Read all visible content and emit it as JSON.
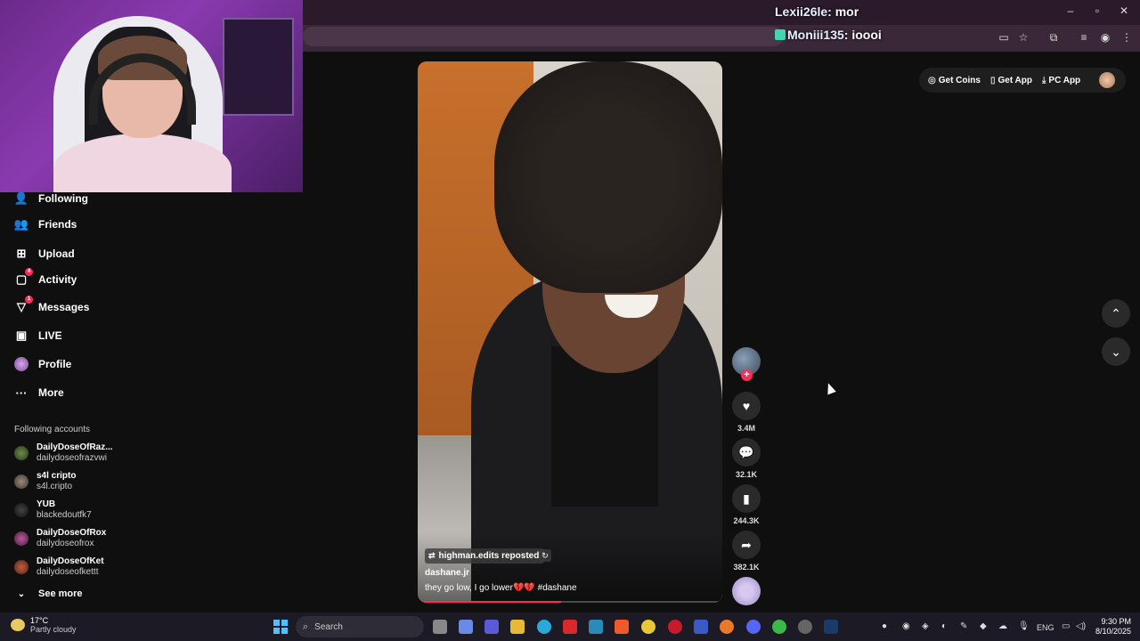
{
  "chat": [
    {
      "user": "Lexii26le",
      "message": "mor",
      "badge": false
    },
    {
      "user": "Moniii135",
      "message": "ioooi",
      "badge": true
    }
  ],
  "sidebar": {
    "items": [
      {
        "label": "Following",
        "icon": "following-icon"
      },
      {
        "label": "Friends",
        "icon": "friends-icon"
      },
      {
        "label": "Upload",
        "icon": "upload-icon"
      },
      {
        "label": "Activity",
        "icon": "activity-icon",
        "badge": "4"
      },
      {
        "label": "Messages",
        "icon": "messages-icon",
        "badge": "1"
      },
      {
        "label": "LIVE",
        "icon": "live-icon"
      },
      {
        "label": "Profile",
        "icon": "profile-avatar"
      },
      {
        "label": "More",
        "icon": "more-icon"
      }
    ],
    "following_title": "Following accounts",
    "accounts": [
      {
        "name": "DailyDoseOfRaz...",
        "handle": "dailydoseofrazvwi"
      },
      {
        "name": "s4l cripto",
        "handle": "s4l.cripto"
      },
      {
        "name": "YUB",
        "handle": "blackedoutfk7"
      },
      {
        "name": "DailyDoseOfRox",
        "handle": "dailydoseofrox"
      },
      {
        "name": "DailyDoseOfKet",
        "handle": "dailydoseofkettt"
      }
    ],
    "see_more": "See more"
  },
  "video": {
    "repost_label": "highman.edits reposted",
    "author": "dashane.jr",
    "caption": "they go low, I go lower💔💔 #dashane",
    "progress": 0.47
  },
  "actions": {
    "likes": "3.4M",
    "comments": "32.1K",
    "saves": "244.3K",
    "shares": "382.1K"
  },
  "topbar": {
    "get_coins": "Get Coins",
    "get_app": "Get App",
    "pc_app": "PC App"
  },
  "taskbar": {
    "temperature": "17°C",
    "weather": "Partly cloudy",
    "search_placeholder": "Search",
    "lang": "ENG",
    "time": "9:30 PM",
    "date": "8/10/2025"
  },
  "colors": {
    "accent": "#fe2c55",
    "background": "#0f0f0f",
    "chrome": "#2a1a2a"
  }
}
